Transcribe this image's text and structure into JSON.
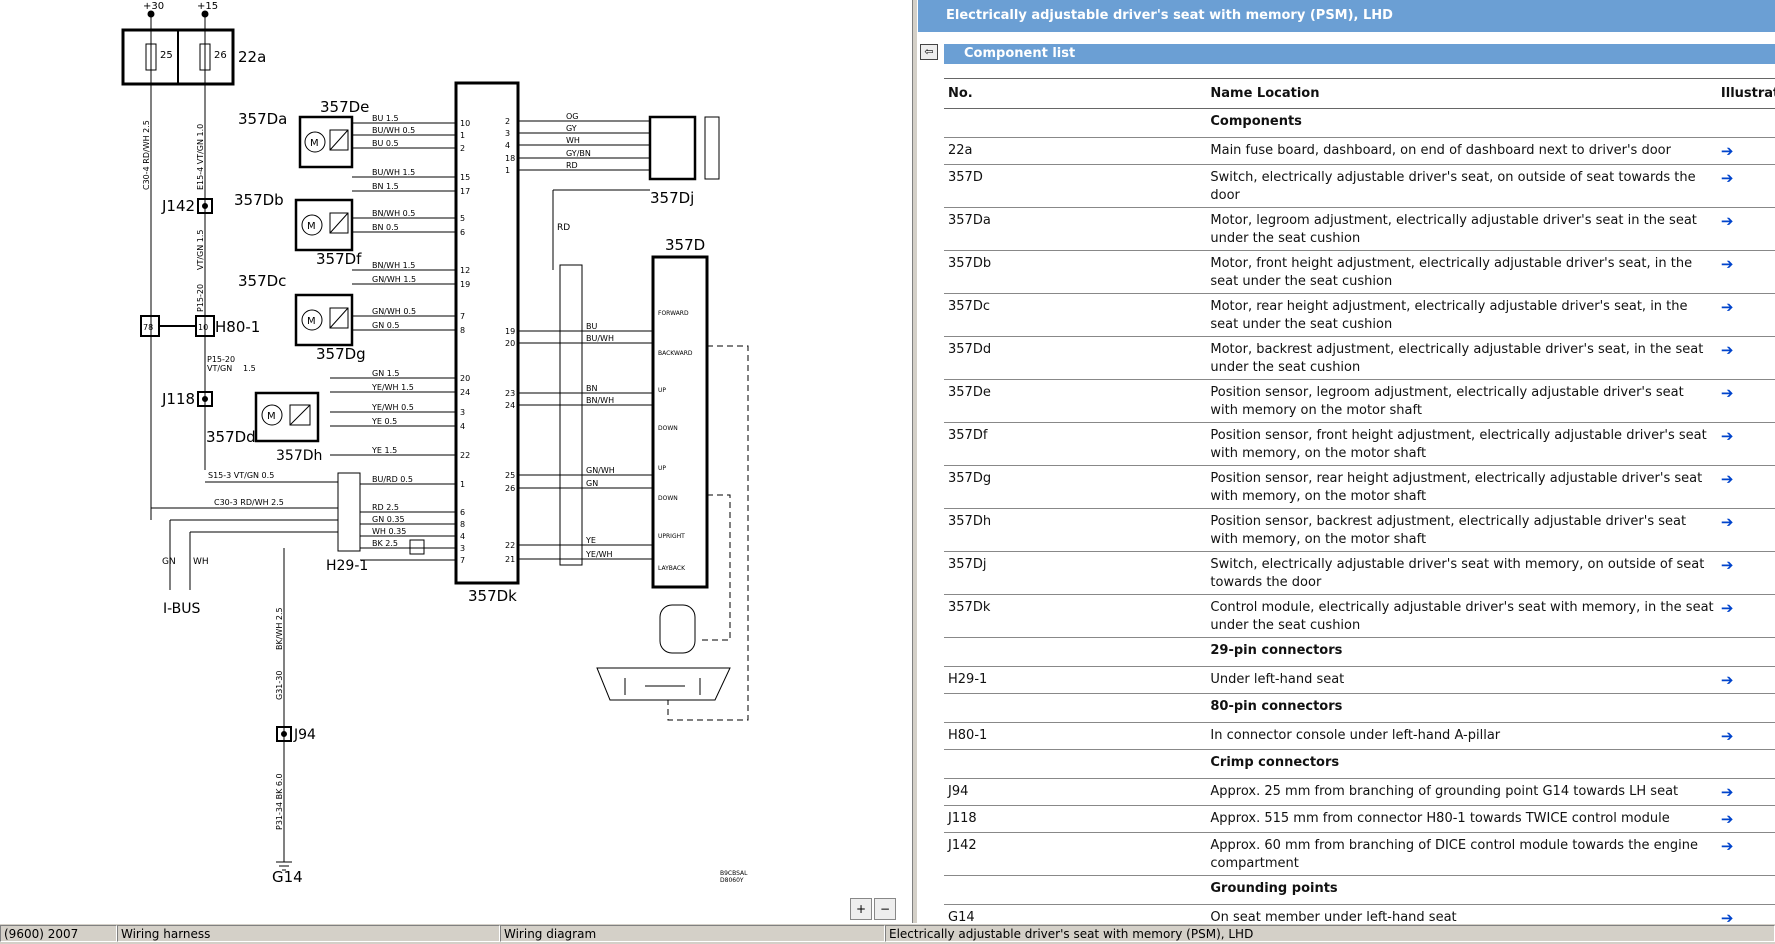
{
  "panel_title": "Electrically adjustable driver's seat with memory (PSM), LHD",
  "section_title": "Component list",
  "table_headers": {
    "no": "No.",
    "name": "Name Location",
    "illustration": "Illustration"
  },
  "rows": [
    {
      "type": "cat",
      "name": "Components"
    },
    {
      "no": "22a",
      "name": "Main fuse board, dashboard, on end of dashboard next to driver's door"
    },
    {
      "no": "357D",
      "name": "Switch, electrically adjustable driver's seat, on outside of seat towards the door"
    },
    {
      "no": "357Da",
      "name": "Motor, legroom adjustment, electrically adjustable driver's seat in the seat under the seat cushion"
    },
    {
      "no": "357Db",
      "name": "Motor, front height adjustment, electrically adjustable driver's seat, in the seat under the seat cushion"
    },
    {
      "no": "357Dc",
      "name": "Motor, rear height adjustment, electrically adjustable driver's seat, in the seat under the seat cushion"
    },
    {
      "no": "357Dd",
      "name": "Motor, backrest adjustment, electrically adjustable driver's seat, in the seat under the seat cushion"
    },
    {
      "no": "357De",
      "name": "Position sensor, legroom adjustment, electrically adjustable driver's seat with memory on the motor shaft"
    },
    {
      "no": "357Df",
      "name": "Position sensor, front height adjustment, electrically adjustable driver's seat with memory, on the motor shaft"
    },
    {
      "no": "357Dg",
      "name": "Position sensor, rear height adjustment, electrically adjustable driver's seat with memory, on the motor shaft"
    },
    {
      "no": "357Dh",
      "name": "Position sensor, backrest adjustment, electrically adjustable driver's seat with memory, on the motor shaft"
    },
    {
      "no": "357Dj",
      "name": "Switch, electrically adjustable driver's seat with memory, on outside of seat towards the door"
    },
    {
      "no": "357Dk",
      "name": "Control module, electrically adjustable driver's seat with memory, in the seat under the seat cushion"
    },
    {
      "type": "cat",
      "name": "29-pin connectors"
    },
    {
      "no": "H29-1",
      "name": "Under left-hand seat"
    },
    {
      "type": "cat",
      "name": "80-pin connectors"
    },
    {
      "no": "H80-1",
      "name": "In connector console under left-hand A-pillar"
    },
    {
      "type": "cat",
      "name": "Crimp connectors"
    },
    {
      "no": "J94",
      "name": "Approx. 25 mm from branching of grounding point G14 towards LH seat"
    },
    {
      "no": "J118",
      "name": "Approx. 515 mm from connector H80-1 towards TWICE control module"
    },
    {
      "no": "J142",
      "name": "Approx. 60 mm from branching of DICE control module towards the engine compartment"
    },
    {
      "type": "cat",
      "name": "Grounding points"
    },
    {
      "no": "G14",
      "name": "On seat member under left-hand seat"
    }
  ],
  "diagram": {
    "labels": {
      "plus30": "+30",
      "plus15": "+15",
      "fuse25": "25",
      "fuse26": "26",
      "fuse_board": "22a",
      "j142": "J142",
      "h80": "H80-1",
      "j118": "J118",
      "h29": "H29-1",
      "j94": "J94",
      "g14": "G14",
      "ibus": "I-BUS",
      "d357da": "357Da",
      "d357db": "357Db",
      "d357dc": "357Dc",
      "d357dd": "357Dd",
      "d357de": "357De",
      "d357df": "357Df",
      "d357dg": "357Dg",
      "d357dh": "357Dh",
      "d357dk": "357Dk",
      "d357d": "357D",
      "d357dj": "357Dj",
      "w1": "C30-4  RD/WH  2.5",
      "w2": "E15-4  VT/GN  1.0",
      "w3": "VT/GN  1.5",
      "w4": "P15-20",
      "w5": "P15-20\nVT/GN",
      "w6": "1.5",
      "w7": "S15-3   VT/GN   0.5",
      "w8": "C30-3   RD/WH   2.5",
      "w9": "BK/WH  2.5",
      "w10": "G31-30",
      "w11": "P31-34  BK  6.0",
      "gn": "GN",
      "wh": "WH",
      "rd": "RD",
      "code": "B9CBSAL\nD8060Y"
    },
    "dk_left_wires": [
      {
        "label": "BU  1.5",
        "pin": "10"
      },
      {
        "label": "BU/WH  0.5",
        "pin": "1"
      },
      {
        "label": "BU  0.5",
        "pin": "2"
      },
      {
        "label": "BU/WH  1.5",
        "pin": "15"
      },
      {
        "label": "BN  1.5",
        "pin": "17"
      },
      {
        "label": "BN/WH  0.5",
        "pin": "5"
      },
      {
        "label": "BN  0.5",
        "pin": "6"
      },
      {
        "label": "BN/WH  1.5",
        "pin": "12"
      },
      {
        "label": "GN/WH  1.5",
        "pin": "19"
      },
      {
        "label": "GN/WH  0.5",
        "pin": "7"
      },
      {
        "label": "GN  0.5",
        "pin": "8"
      },
      {
        "label": "GN  1.5",
        "pin": "20"
      },
      {
        "label": "YE/WH  1.5",
        "pin": "24"
      },
      {
        "label": "YE/WH  0.5",
        "pin": "3"
      },
      {
        "label": "YE  0.5",
        "pin": "4"
      },
      {
        "label": "YE  1.5",
        "pin": "22"
      },
      {
        "label": "BU/RD  0.5",
        "pin": "1"
      },
      {
        "label": "RD  2.5",
        "pin": "6"
      },
      {
        "label": "GN  0.35",
        "pin": "8"
      },
      {
        "label": "WH  0.35",
        "pin": "4"
      },
      {
        "label": "BK  2.5",
        "pin": "3"
      },
      {
        "label": "",
        "pin": "7"
      }
    ],
    "dk_right_wires": [
      {
        "label": "OG",
        "pin": "2"
      },
      {
        "label": "GY",
        "pin": "3"
      },
      {
        "label": "WH",
        "pin": "4"
      },
      {
        "label": "GY/BN",
        "pin": "18"
      },
      {
        "label": "RD",
        "pin": "1"
      },
      {
        "label": "BU",
        "pin": "19"
      },
      {
        "label": "BU/WH",
        "pin": "20"
      },
      {
        "label": "BN",
        "pin": "23"
      },
      {
        "label": "BN/WH",
        "pin": "24"
      },
      {
        "label": "GN/WH",
        "pin": "25"
      },
      {
        "label": "GN",
        "pin": "26"
      },
      {
        "label": "YE",
        "pin": "22"
      },
      {
        "label": "YE/WH",
        "pin": "21"
      }
    ],
    "switch_labels": [
      "FORWARD",
      "BACKWARD",
      "UP",
      "DOWN",
      "UP",
      "DOWN",
      "UPRIGHT",
      "LAYBACK"
    ]
  },
  "zoom_in": "+",
  "zoom_out": "−",
  "status": {
    "s1": "(9600) 2007",
    "s2": "Wiring harness",
    "s3": "Wiring diagram",
    "s4": "Electrically adjustable driver's seat with memory (PSM), LHD"
  }
}
